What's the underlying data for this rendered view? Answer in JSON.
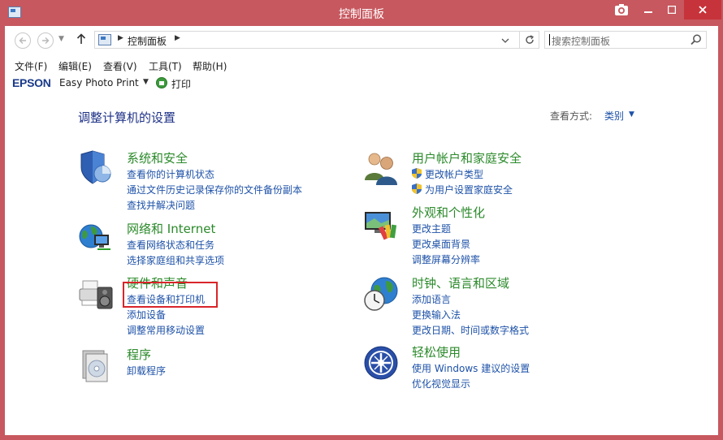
{
  "window": {
    "title": "控制面板"
  },
  "navigation": {
    "breadcrumb": "控制面板",
    "search_placeholder": "搜索控制面板"
  },
  "menu": [
    {
      "label": "文件(F)"
    },
    {
      "label": "编辑(E)"
    },
    {
      "label": "查看(V)"
    },
    {
      "label": "工具(T)"
    },
    {
      "label": "帮助(H)"
    }
  ],
  "epson_toolbar": {
    "brand": "EPSON",
    "app": "Easy Photo Print",
    "print": "打印"
  },
  "content": {
    "heading": "调整计算机的设置",
    "view_by_label": "查看方式:",
    "view_by_value": "类别"
  },
  "categories": [
    {
      "title": "系统和安全",
      "icon": "system-security-icon",
      "links": [
        "查看你的计算机状态",
        "通过文件历史记录保存你的文件备份副本",
        "查找并解决问题"
      ]
    },
    {
      "title": "用户帐户和家庭安全",
      "icon": "user-accounts-icon",
      "links": [
        "更改帐户类型",
        "为用户设置家庭安全"
      ]
    },
    {
      "title": "网络和 Internet",
      "icon": "network-internet-icon",
      "links": [
        "查看网络状态和任务",
        "选择家庭组和共享选项"
      ]
    },
    {
      "title": "外观和个性化",
      "icon": "appearance-personalization-icon",
      "links": [
        "更改主题",
        "更改桌面背景",
        "调整屏幕分辨率"
      ]
    },
    {
      "title": "硬件和声音",
      "icon": "hardware-sound-icon",
      "links": [
        "查看设备和打印机",
        "添加设备",
        "调整常用移动设置"
      ]
    },
    {
      "title": "时钟、语言和区域",
      "icon": "clock-language-region-icon",
      "links": [
        "添加语言",
        "更换输入法",
        "更改日期、时间或数字格式"
      ]
    },
    {
      "title": "程序",
      "icon": "programs-icon",
      "links": [
        "卸载程序"
      ]
    },
    {
      "title": "轻松使用",
      "icon": "ease-of-access-icon",
      "links": [
        "使用 Windows 建议的设置",
        "优化视觉显示"
      ]
    }
  ]
}
